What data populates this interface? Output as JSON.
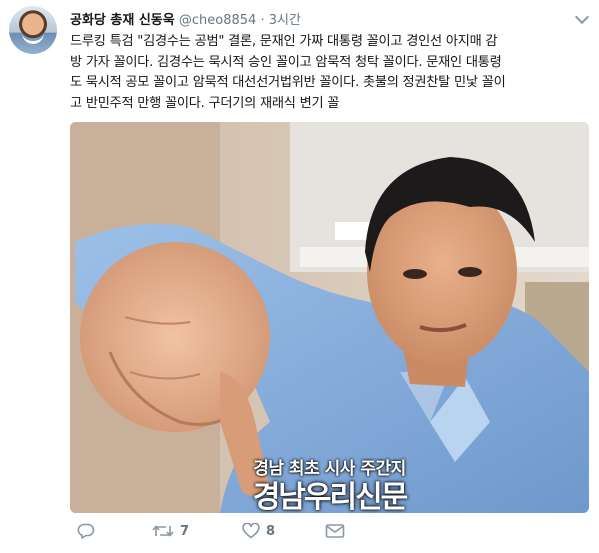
{
  "tweet": {
    "author_name": "공화당 총재 신동욱",
    "handle": "@cheo8854",
    "separator": "·",
    "time": "3시간",
    "text_lines": [
      "드루킹 특검 \"김경수는 공범\" 결론, 문재인 가짜 대통령 꼴이고 경인선 아지매 감",
      "방 가자 꼴이다. 김경수는 묵시적 승인 꼴이고 암묵적 청탁 꼴이다. 문재인 대통령",
      "도 묵시적 공모 꼴이고 암묵적 대선선거법위반 꼴이다. 촛불의 정권찬탈 민낯 꼴이",
      "고 반민주적 만행 꼴이다. 구더기의 재래식 변기 꼴"
    ]
  },
  "media": {
    "watermark_line1": "경남 최초 시사 주간지",
    "watermark_line2": "경남우리신문"
  },
  "actions": {
    "reply_count": "",
    "retweet_count": "7",
    "like_count": "8"
  },
  "colors": {
    "text": "#14171a",
    "secondary": "#657786",
    "icon": "#8899a6"
  }
}
